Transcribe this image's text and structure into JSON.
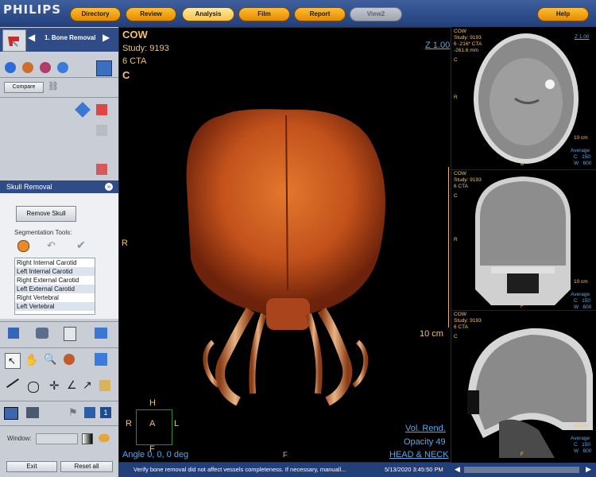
{
  "app": {
    "logo": "PHILIPS"
  },
  "tabs": [
    {
      "label": "Directory"
    },
    {
      "label": "Review"
    },
    {
      "label": "Analysis"
    },
    {
      "label": "Film"
    },
    {
      "label": "Report"
    },
    {
      "label": "View2"
    }
  ],
  "help": "Help",
  "workflow": {
    "step": "1. Bone Removal"
  },
  "compare": "Compare",
  "skull_panel": {
    "title": "Skull Removal",
    "remove_button": "Remove Skull",
    "seg_label": "Segmentation Tools:",
    "vessels": [
      "Right Internal Carotid",
      "Left Internal Carotid",
      "Right External Carotid",
      "Left External Carotid",
      "Right Vertebral",
      "Left Vertebral"
    ]
  },
  "window": {
    "label": "Window:"
  },
  "footer_buttons": {
    "exit": "Exit",
    "reset": "Reset all"
  },
  "main_view": {
    "title": "COW",
    "study": "Study: 9193",
    "series": "6 CTA",
    "view": "C",
    "zoom": "Z 1.00",
    "right_marker": "R",
    "scale": "10 cm",
    "orient_h": "H",
    "orient_r": "R",
    "orient_a": "A",
    "orient_l": "L",
    "orient_f": "F",
    "bottom_f": "F",
    "angle": "Angle 0, 0, 0 deg",
    "mode": "Vol. Rend.",
    "opacity": "Opacity 49",
    "protocol": "HEAD & NECK"
  },
  "axial": {
    "title": "COW",
    "study": "Study: 9193",
    "series": "6 -216* CTA",
    "pos": "-261.6 mm",
    "view": "C",
    "zoom": "Z 1.00",
    "r": "R",
    "b": "B",
    "scale": "10 cm",
    "avg": "Average",
    "c": "C   150",
    "w": "W   600"
  },
  "coronal": {
    "title": "COW",
    "study": "Study: 9193",
    "series": "6 CTA",
    "view": "C",
    "r": "R",
    "f": "F",
    "scale": "10 cm",
    "avg": "Average",
    "c": "C   150",
    "w": "W   600"
  },
  "sagittal": {
    "title": "COW",
    "study": "Study: 9193",
    "series": "6 CTA",
    "view": "C",
    "f": "F",
    "scale": "10 cm",
    "avg": "Average",
    "c": "C   150",
    "w": "W   600"
  },
  "status": {
    "message": "Verify bone removal did not affect vessels completeness. If necessary, manuall...",
    "datetime": "5/13/2020 3:45:50 PM"
  },
  "colors": {
    "accent": "#f5a31a",
    "panel_blue": "#2f4c86",
    "overlay": "#f5c26a",
    "overlay_blue": "#5aa8e6"
  }
}
